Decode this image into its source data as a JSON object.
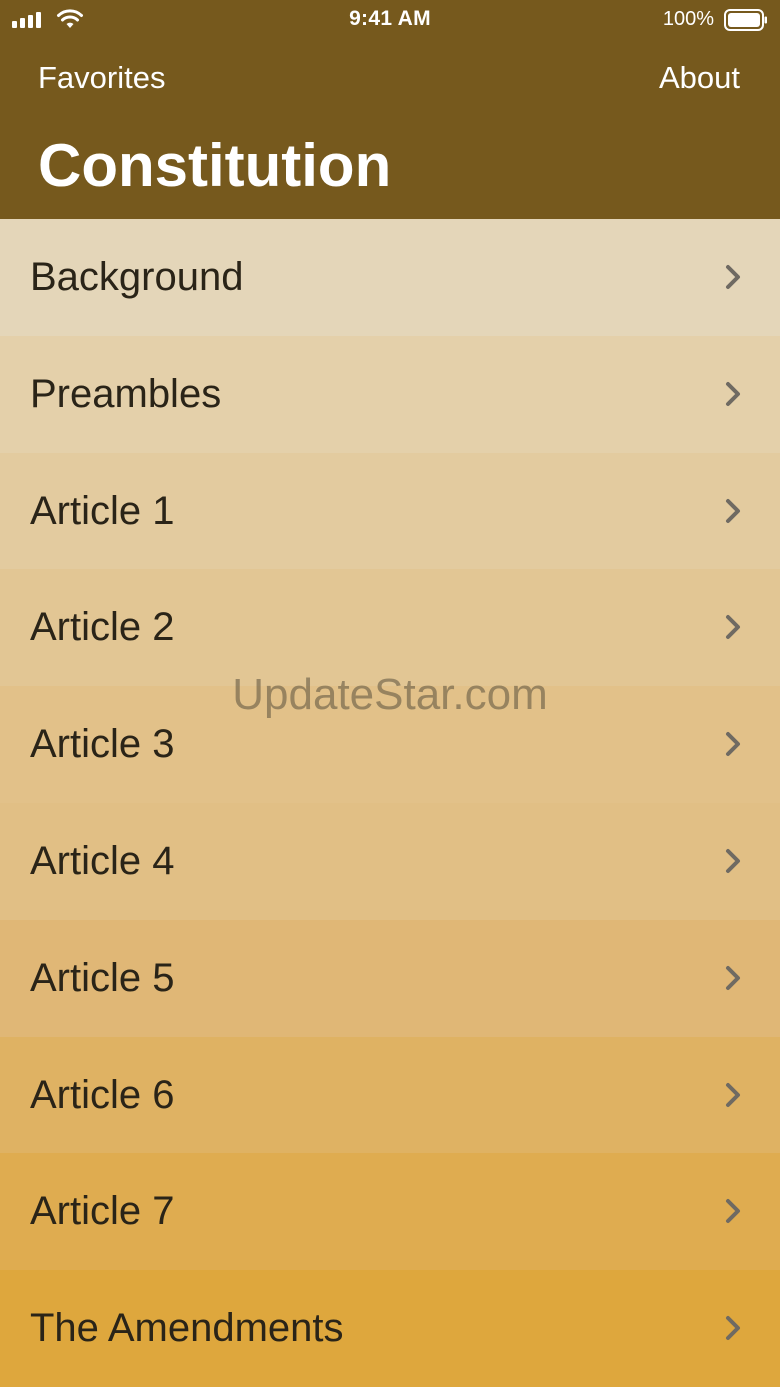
{
  "status_bar": {
    "time": "9:41 AM",
    "battery_percent": "100%",
    "battery_level": 1.0,
    "signal_bars": 4,
    "icons": [
      "signal-icon",
      "wifi-icon",
      "battery-icon"
    ]
  },
  "nav": {
    "left_label": "Favorites",
    "right_label": "About"
  },
  "title": "Constitution",
  "colors": {
    "header_bg": "#76591d",
    "text": "#2a2418",
    "chevron": "#6f6a62",
    "row_gradient_start": "#e4d6b9",
    "row_gradient_end": "#dea73d"
  },
  "list": {
    "items": [
      {
        "label": "Background",
        "bg": "#e4d6b9"
      },
      {
        "label": "Preambles",
        "bg": "#e4d0aa"
      },
      {
        "label": "Article 1",
        "bg": "#e3cb9f"
      },
      {
        "label": "Article 2",
        "bg": "#e2c694"
      },
      {
        "label": "Article 3",
        "bg": "#e2c189"
      },
      {
        "label": "Article 4",
        "bg": "#e1bf85"
      },
      {
        "label": "Article 5",
        "bg": "#e0b776"
      },
      {
        "label": "Article 6",
        "bg": "#dfb263"
      },
      {
        "label": "Article 7",
        "bg": "#dfac50"
      },
      {
        "label": "The Amendments",
        "bg": "#dea73d"
      }
    ]
  },
  "watermark": "UpdateStar.com"
}
